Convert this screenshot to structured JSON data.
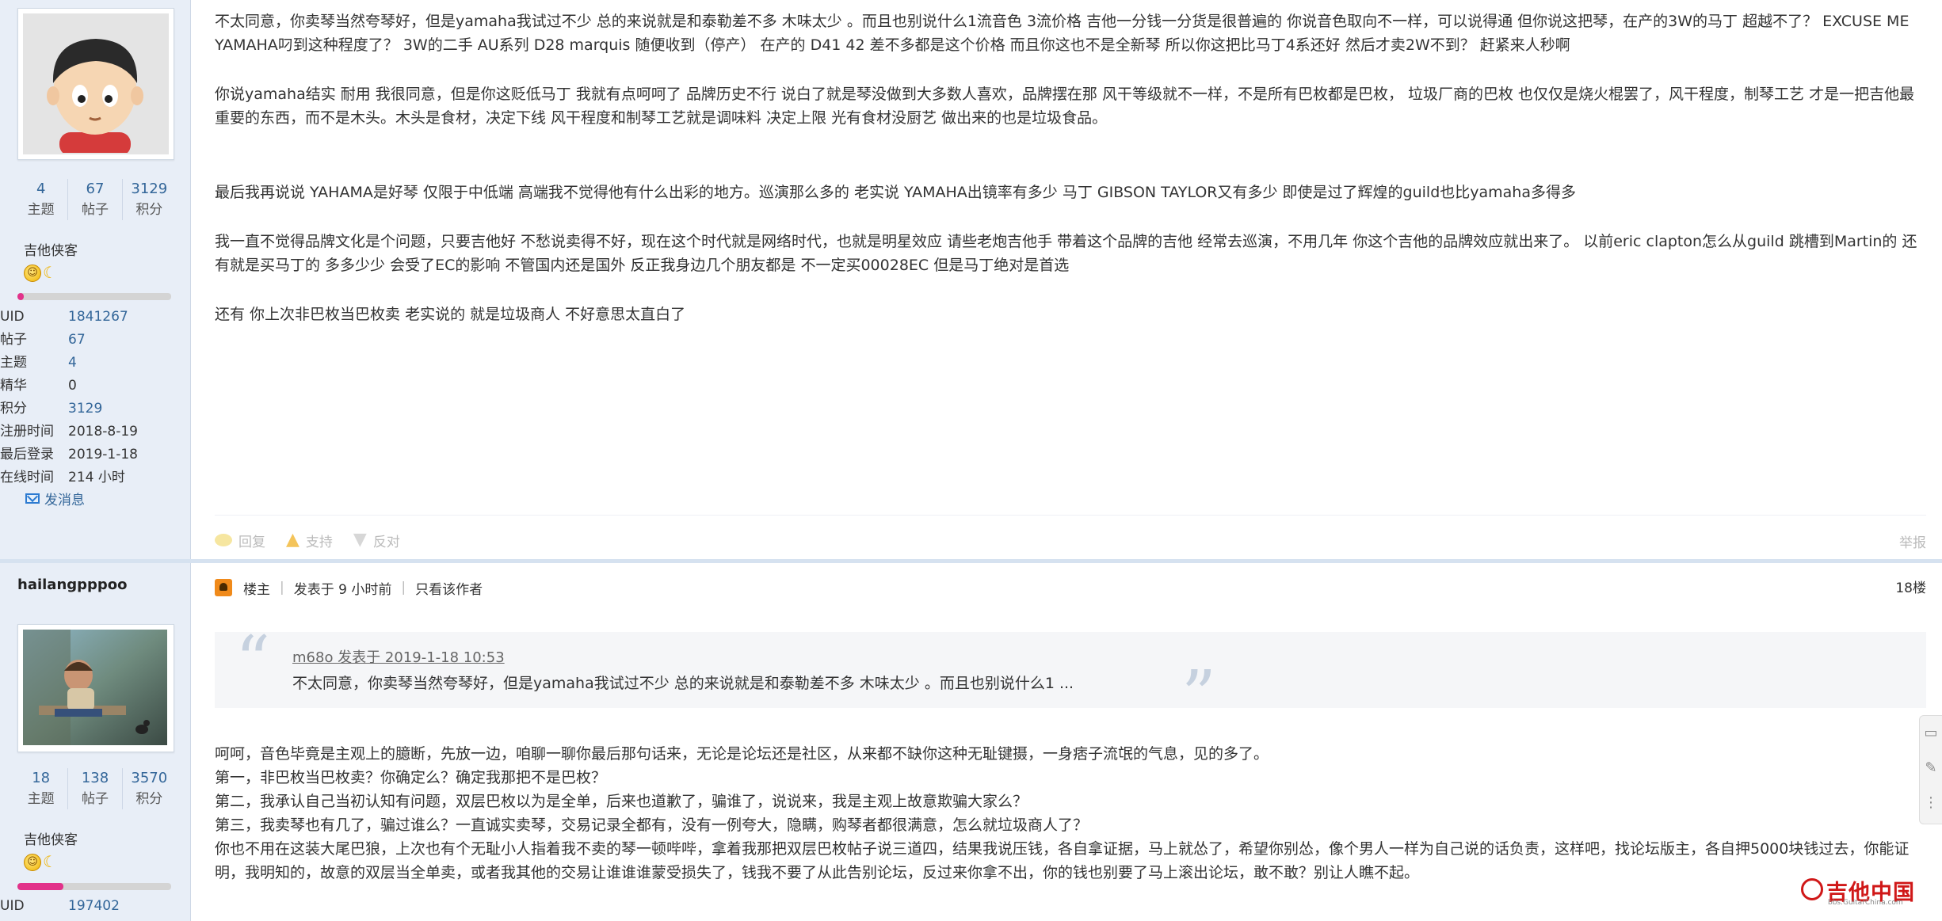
{
  "posts": [
    {
      "author": {
        "stats": [
          {
            "value": "4",
            "label": "主题"
          },
          {
            "value": "67",
            "label": "帖子"
          },
          {
            "value": "3129",
            "label": "积分"
          }
        ],
        "rank": "吉他侠客",
        "progress_fraction": 0.04,
        "info": [
          {
            "key": "UID",
            "value": "1841267"
          },
          {
            "key": "帖子",
            "value": "67"
          },
          {
            "key": "主题",
            "value": "4"
          },
          {
            "key": "精华",
            "value": "0"
          },
          {
            "key": "积分",
            "value": "3129"
          },
          {
            "key": "注册时间",
            "value": "2018-8-19"
          },
          {
            "key": "最后登录",
            "value": "2019-1-18"
          },
          {
            "key": "在线时间",
            "value": "214 小时"
          }
        ],
        "send_message": "发消息"
      },
      "paragraphs": [
        "不太同意，你卖琴当然夸琴好，但是yamaha我试过不少 总的来说就是和泰勒差不多 木味太少 。而且也别说什么1流音色 3流价格 吉他一分钱一分货是很普遍的 你说音色取向不一样，可以说得通 但你说这把琴，在产的3W的马丁 超越不了？ EXCUSE ME YAMAHA叼到这种程度了？ 3W的二手 AU系列 D28 marquis 随便收到（停产） 在产的 D41 42 差不多都是这个价格 而且你这也不是全新琴 所以你这把比马丁4系还好 然后才卖2W不到？ 赶紧来人秒啊",
        "你说yamaha结实 耐用 我很同意，但是你这贬低马丁 我就有点呵呵了 品牌历史不行 说白了就是琴没做到大多数人喜欢，品牌摆在那 风干等级就不一样，不是所有巴枚都是巴枚， 垃圾厂商的巴枚 也仅仅是烧火棍罢了，风干程度，制琴工艺 才是一把吉他最重要的东西，而不是木头。木头是食材，决定下线 风干程度和制琴工艺就是调味料 决定上限 光有食材没厨艺 做出来的也是垃圾食品。",
        "最后我再说说 YAHAMA是好琴 仅限于中低端 高端我不觉得他有什么出彩的地方。巡演那么多的 老实说 YAMAHA出镜率有多少 马丁 GIBSON TAYLOR又有多少 即使是过了辉煌的guild也比yamaha多得多",
        "我一直不觉得品牌文化是个问题，只要吉他好 不愁说卖得不好，现在这个时代就是网络时代，也就是明星效应 请些老炮吉他手 带着这个品牌的吉他 经常去巡演，不用几年 你这个吉他的品牌效应就出来了。 以前eric clapton怎么从guild 跳槽到Martin的 还有就是买马丁的 多多少少 会受了EC的影响 不管国内还是国外 反正我身边几个朋友都是 不一定买00028EC 但是马丁绝对是首选",
        "还有 你上次非巴枚当巴枚卖 老实说的 就是垃圾商人 不好意思太直白了"
      ],
      "actions": {
        "reply": "回复",
        "support": "支持",
        "oppose": "反对",
        "report": "举报"
      }
    },
    {
      "author": {
        "name": "hailangpppoo",
        "stats": [
          {
            "value": "18",
            "label": "主题"
          },
          {
            "value": "138",
            "label": "帖子"
          },
          {
            "value": "3570",
            "label": "积分"
          }
        ],
        "rank": "吉他侠客",
        "progress_fraction": 0.3,
        "info": [
          {
            "key": "UID",
            "value": "197402"
          }
        ]
      },
      "header": {
        "owner_label": "楼主",
        "posted": "发表于 9 小时前",
        "only_author": "只看该作者",
        "floor": "18楼"
      },
      "quote": {
        "author_line": "m68o 发表于 2019-1-18 10:53",
        "text": "不太同意，你卖琴当然夸琴好，但是yamaha我试过不少 总的来说就是和泰勒差不多 木味太少 。而且也别说什么1 ..."
      },
      "lines": [
        "呵呵，音色毕竟是主观上的臆断，先放一边，咱聊一聊你最后那句话来，无论是论坛还是社区，从来都不缺你这种无耻键摄，一身痞子流氓的气息，见的多了。",
        "第一，非巴枚当巴枚卖？你确定么？确定我那把不是巴枚？",
        "第二，我承认自己当初认知有问题，双层巴枚以为是全单，后来也道歉了，骗谁了，说说来，我是主观上故意欺骗大家么？",
        "第三，我卖琴也有几了，骗过谁么？一直诚实卖琴，交易记录全都有，没有一例夸大，隐瞒，购琴者都很满意，怎么就垃圾商人了？",
        "你也不用在这装大尾巴狼，上次也有个无耻小人指着我不卖的琴一顿哔哔，拿着我那把双层巴枚帖子说三道四，结果我说压钱，各自拿证据，马上就怂了，希望你别怂，像个男人一样为自己说的话负责，这样吧，找论坛版主，各自押5000块钱过去，你能证明，我明知的，故意的双层当全单卖，或者我其他的交易让谁谁谁蒙受损失了，钱我不要了从此告别论坛，反过来你拿不出，你的钱也别要了马上滚出论坛，敢不敢？别让人瞧不起。"
      ]
    }
  ],
  "watermark": {
    "text": "吉他中国",
    "url": "bbs.GuitarChina.com"
  },
  "colors": {
    "link": "#336699",
    "sidebar": "#e8eef7",
    "progress": "#e2328a",
    "watermark": "#d01818"
  }
}
